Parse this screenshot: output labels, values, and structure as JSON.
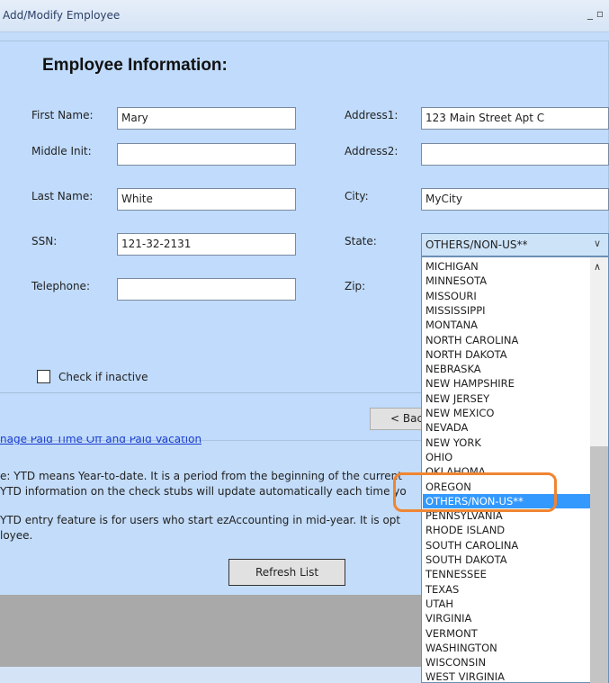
{
  "window": {
    "title": "Add/Modify Employee",
    "controls": "_ ▫"
  },
  "heading": "Employee Information:",
  "fields": {
    "first_name": {
      "label": "First Name:",
      "value": "Mary"
    },
    "middle_init": {
      "label": "Middle Init:",
      "value": ""
    },
    "last_name": {
      "label": "Last Name:",
      "value": "White"
    },
    "ssn": {
      "label": "SSN:",
      "value": "121-32-2131"
    },
    "telephone": {
      "label": "Telephone:",
      "value": ""
    },
    "address1": {
      "label": "Address1:",
      "value": "123 Main Street Apt C"
    },
    "address2": {
      "label": "Address2:",
      "value": ""
    },
    "city": {
      "label": "City:",
      "value": "MyCity"
    },
    "state": {
      "label": "State:",
      "value": "OTHERS/NON-US**"
    },
    "zip": {
      "label": "Zip:"
    }
  },
  "inactive_label": "Check if inactive",
  "back_button": "< Bac",
  "link": "nage Paid Time Off and Paid Vacation",
  "notes": [
    "e: YTD means Year-to-date. It is a period from the beginning of the current",
    "YTD information on the check stubs will update automatically each time yo",
    "",
    "YTD entry feature is for users who start ezAccounting in mid-year. It is opt",
    "loyee."
  ],
  "refresh_button": "Refresh List",
  "state_options": [
    "MICHIGAN",
    "MINNESOTA",
    "MISSOURI",
    "MISSISSIPPI",
    "MONTANA",
    "NORTH CAROLINA",
    "NORTH DAKOTA",
    "NEBRASKA",
    "NEW HAMPSHIRE",
    "NEW JERSEY",
    "NEW MEXICO",
    "NEVADA",
    "NEW YORK",
    "OHIO",
    "OKLAHOMA",
    "OREGON",
    "OTHERS/NON-US**",
    "PENNSYLVANIA",
    "RHODE ISLAND",
    "SOUTH CAROLINA",
    "SOUTH DAKOTA",
    "TENNESSEE",
    "TEXAS",
    "UTAH",
    "VIRGINIA",
    "VERMONT",
    "WASHINGTON",
    "WISCONSIN",
    "WEST VIRGINIA"
  ],
  "selected_state": "OTHERS/NON-US**",
  "colors": {
    "highlight": "#3399ff",
    "annotation": "#f08532",
    "panel": "#c0dbfb"
  }
}
